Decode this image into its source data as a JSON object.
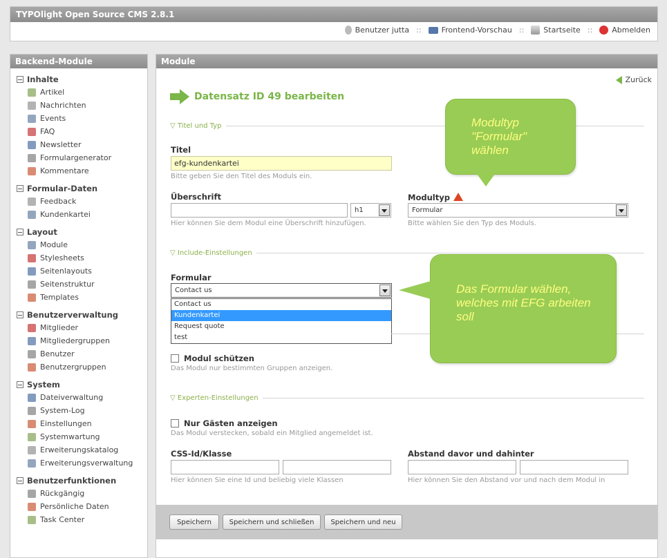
{
  "app": {
    "title": "TYPOlight Open Source CMS 2.8.1"
  },
  "header_links": {
    "user": "Benutzer jutta",
    "preview": "Frontend-Vorschau",
    "home": "Startseite",
    "logout": "Abmelden",
    "separator": "::"
  },
  "sidebar": {
    "title": "Backend-Module",
    "groups": [
      {
        "title": "Inhalte",
        "items": [
          "Artikel",
          "Nachrichten",
          "Events",
          "FAQ",
          "Newsletter",
          "Formulargenerator",
          "Kommentare"
        ]
      },
      {
        "title": "Formular-Daten",
        "items": [
          "Feedback",
          "Kundenkartei"
        ]
      },
      {
        "title": "Layout",
        "items": [
          "Module",
          "Stylesheets",
          "Seitenlayouts",
          "Seitenstruktur",
          "Templates"
        ]
      },
      {
        "title": "Benutzerverwaltung",
        "items": [
          "Mitglieder",
          "Mitgliedergruppen",
          "Benutzer",
          "Benutzergruppen"
        ]
      },
      {
        "title": "System",
        "items": [
          "Dateiverwaltung",
          "System-Log",
          "Einstellungen",
          "Systemwartung",
          "Erweiterungskatalog",
          "Erweiterungsverwaltung"
        ]
      },
      {
        "title": "Benutzerfunktionen",
        "items": [
          "Rückgängig",
          "Persönliche Daten",
          "Task Center"
        ]
      }
    ]
  },
  "main": {
    "title": "Module",
    "back_label": "Zurück",
    "heading": "Datensatz ID 49 bearbeiten",
    "legends": {
      "title_type": "Titel und Typ",
      "include": "Include-Einstellungen",
      "expert": "Experten-Einstellungen"
    },
    "fields": {
      "title": {
        "label": "Titel",
        "value": "efg-kundenkartei",
        "hint": "Bitte geben Sie den Titel des Moduls ein."
      },
      "headline": {
        "label": "Überschrift",
        "value": "",
        "level": "h1",
        "hint": "Hier können Sie dem Modul eine Überschrift hinzufügen."
      },
      "type": {
        "label": "Modultyp",
        "value": "Formular",
        "hint": "Bitte wählen Sie den Typ des Moduls."
      },
      "form": {
        "label": "Formular",
        "value": "Contact us",
        "options": [
          "Contact us",
          "Kundenkartei",
          "Request quote",
          "test"
        ],
        "selected_index": 1
      },
      "protect": {
        "label": "Modul schützen",
        "hint": "Das Modul nur bestimmten Gruppen anzeigen."
      },
      "guests": {
        "label": "Nur Gästen anzeigen",
        "hint": "Das Modul verstecken, sobald ein Mitglied angemeldet ist."
      },
      "css": {
        "label": "CSS-Id/Klasse",
        "hint": "Hier können Sie eine Id und beliebig viele Klassen"
      },
      "space": {
        "label": "Abstand davor und dahinter",
        "hint": "Hier können Sie den Abstand vor und nach dem Modul in"
      }
    },
    "buttons": {
      "save": "Speichern",
      "save_close": "Speichern und schließen",
      "save_new": "Speichern und neu"
    }
  },
  "callouts": {
    "modultyp": [
      "Modultyp",
      "\"Formular\"",
      "wählen"
    ],
    "formular": [
      "Das Formular wählen,",
      "welches mit EFG arbeiten",
      "soll"
    ]
  },
  "colors": {
    "accent": "#7ab648",
    "bubble": "#99cc55",
    "bubble_text": "#fdfd80",
    "selection": "#3399ff"
  }
}
